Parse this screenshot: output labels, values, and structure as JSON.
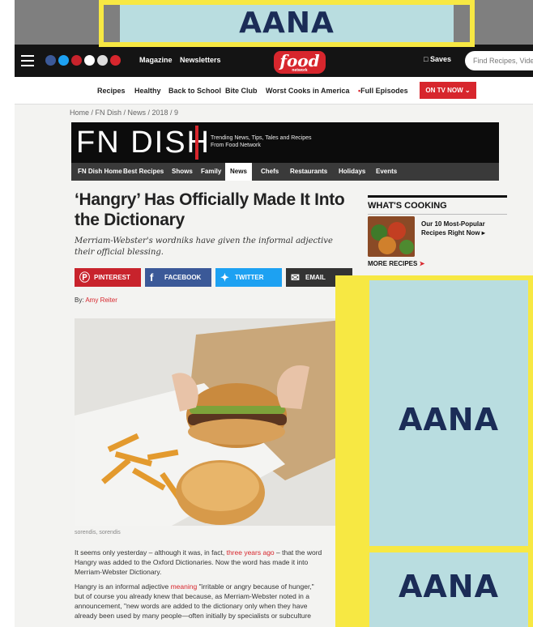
{
  "topnav": {
    "nav_links": [
      "Magazine",
      "Newsletters"
    ],
    "logo_text": "food",
    "logo_sub": "network",
    "saves_label": "Saves",
    "search_placeholder": "Find Recipes, Video"
  },
  "subnav": {
    "items": [
      "Recipes",
      "Healthy",
      "Back to School",
      "Bite Club",
      "Worst Cooks in America",
      "Full Episodes"
    ],
    "on_tv_label": "ON TV NOW"
  },
  "breadcrumb": "Home / FN Dish / News / 2018 / 9",
  "fn_dish": {
    "logo": "FN DISH",
    "tagline_1": "Trending News, Tips, Tales and Recipes",
    "tagline_2": "From Food Network",
    "nav": [
      "FN Dish Home",
      "Best Recipes",
      "Shows",
      "Family",
      "News",
      "Chefs",
      "Restaurants",
      "Holidays",
      "Events"
    ],
    "active_nav": "News"
  },
  "article": {
    "headline": "‘Hangry’ Has Officially Made It Into the Dictionary",
    "dek": "Merriam-Webster's wordniks have given the informal adjective their official blessing.",
    "byline_prefix": "By:",
    "author": "Amy Reiter",
    "photo_caption": "sorendis, sorendis",
    "share": {
      "pinterest": "PINTEREST",
      "facebook": "FACEBOOK",
      "twitter": "TWITTER",
      "email": "EMAIL"
    },
    "para1_a": "It seems only yesterday – although it was, in fact, ",
    "para1_link": "three years ago",
    "para1_b": " – that the word",
    "para1_line2": "Hangry was added to the Oxford Dictionaries. Now the word has made it into",
    "para1_line3": "Merriam-Webster Dictionary.",
    "para2_a": "Hangry is an informal adjective ",
    "para2_link": "meaning",
    "para2_b": " \"irritable or angry because of hunger,\"",
    "para2_line2": "but of course you already knew that because, as Merriam-Webster noted in a",
    "para2_line3": "announcement, \"new words are added to the dictionary only when they have",
    "para2_line4": "already been used by many people—often initially by specialists or subculture"
  },
  "sidebar": {
    "heading": "WHAT'S COOKING",
    "feature": "Our 10 Most-Popular Recipes Right Now",
    "more": "MORE RECIPES"
  },
  "ads": {
    "label": "AANA"
  },
  "colors": {
    "brand_red": "#d7262d",
    "ad_yellow": "#f7e843",
    "ad_blue": "#b9dde0",
    "aana_navy": "#1b2c57",
    "pinterest": "#c8232c",
    "facebook": "#3b5998",
    "twitter": "#1da1f2"
  }
}
